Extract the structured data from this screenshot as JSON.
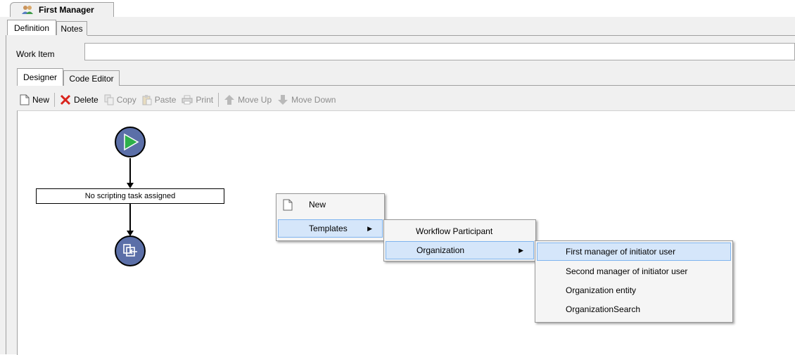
{
  "document_tab": {
    "title": "First Manager"
  },
  "tabs": {
    "definition": "Definition",
    "notes": "Notes"
  },
  "work_item": {
    "label": "Work Item",
    "value": ""
  },
  "designer_tabs": {
    "designer": "Designer",
    "code_editor": "Code Editor"
  },
  "toolbar": {
    "new": "New",
    "delete": "Delete",
    "copy": "Copy",
    "paste": "Paste",
    "print": "Print",
    "move_up": "Move Up",
    "move_down": "Move Down"
  },
  "workflow": {
    "task_label": "No scripting task assigned"
  },
  "context_menu": {
    "items": [
      "New",
      "Templates"
    ],
    "templates_submenu": [
      "Workflow Participant",
      "Organization"
    ],
    "organization_submenu": [
      "First manager of initiator user",
      "Second manager of initiator user",
      "Organization entity",
      "OrganizationSearch"
    ]
  },
  "colors": {
    "highlight": "#d5e6fa",
    "highlight_border": "#7fb4ee",
    "node_fill": "#5b6fa8",
    "start_arrow": "#2eb04a"
  }
}
